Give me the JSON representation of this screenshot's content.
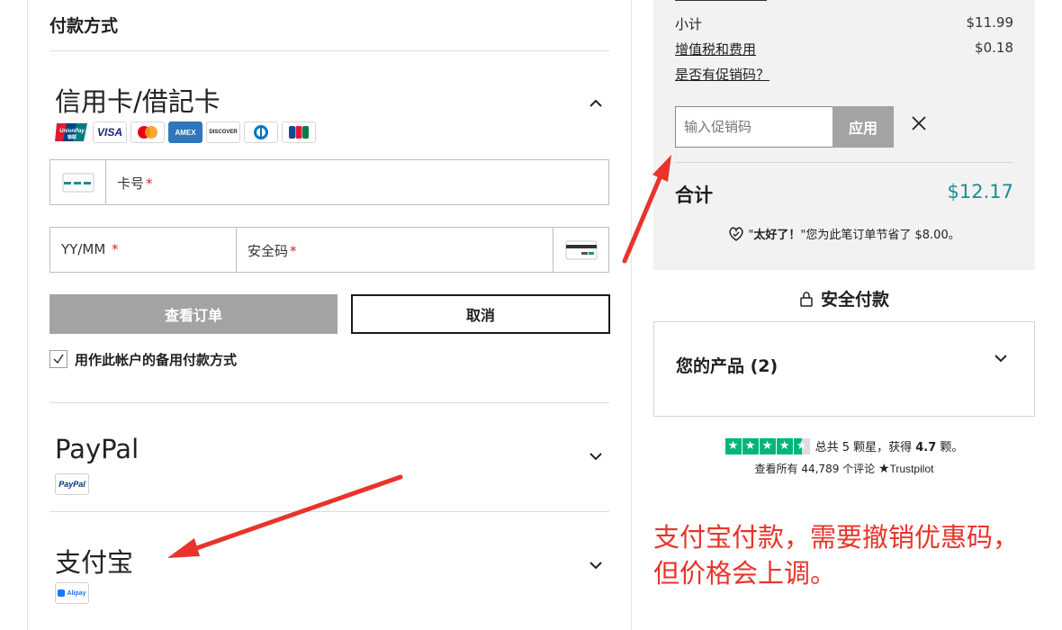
{
  "payment": {
    "section_title": "付款方式",
    "card": {
      "title": "信用卡/借記卡",
      "brands": [
        "UnionPay",
        "VISA",
        "Mastercard",
        "AMEX",
        "DISCOVER",
        "Diners",
        "JCB"
      ],
      "card_number_label": "卡号",
      "expiry_label": "YY/MM",
      "cvv_label": "安全码",
      "required_mark": "*",
      "review_button": "查看订单",
      "cancel_button": "取消",
      "backup_checkbox_label": "用作此帐户的备用付款方式",
      "backup_checked": true
    },
    "paypal": {
      "title": "PayPal",
      "logo_text": "PayPal"
    },
    "alipay": {
      "title": "支付宝",
      "logo_text": "Alipay"
    }
  },
  "summary": {
    "subtotal_label": "小计",
    "subtotal_value": "$11.99",
    "tax_label": "增值税和费用",
    "tax_value": "$0.18",
    "promo_question": "是否有促销码？",
    "promo_placeholder": "输入促销码",
    "promo_apply": "应用",
    "total_label": "合计",
    "total_value": "$12.17",
    "saved_prefix": "\"",
    "saved_bold": "太好了！",
    "saved_suffix": "\"您为此笔订单节省了 $8.00。"
  },
  "secure_payment": "安全付款",
  "products": {
    "title": "您的产品 (2)"
  },
  "trustpilot": {
    "rating_text_pre": "总共 5 颗星，获得 ",
    "rating_value": "4.7",
    "rating_text_post": " 颗。",
    "reviews_text": "查看所有 44,789 个评论",
    "brand": "Trustpilot",
    "rating_fraction": 0.94
  },
  "annotation": {
    "line1": "支付宝付款，需要撤销优惠码，",
    "line2": "但价格会上调。",
    "color": "#e8342b"
  },
  "colors": {
    "accent": "#1f8d8d",
    "button_disabled": "#a3a3a3",
    "trustpilot_green": "#00b67a"
  }
}
